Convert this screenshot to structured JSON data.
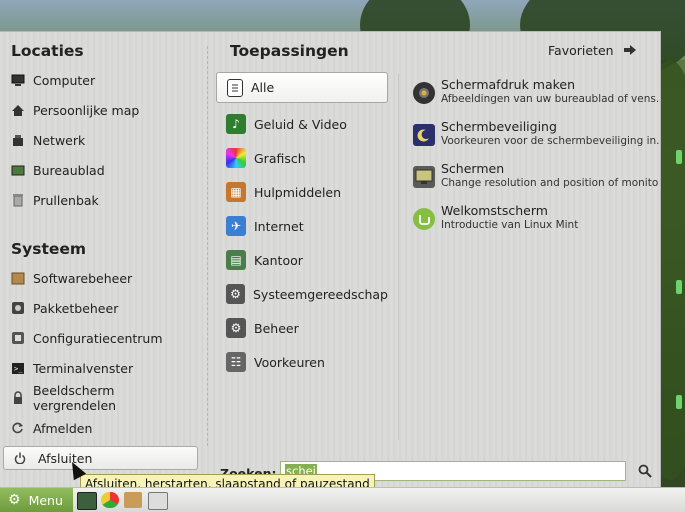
{
  "left_panel": {
    "places_title": "Locaties",
    "places": [
      {
        "label": "Computer",
        "icon": "computer-icon"
      },
      {
        "label": "Persoonlijke map",
        "icon": "home-icon"
      },
      {
        "label": "Netwerk",
        "icon": "network-icon"
      },
      {
        "label": "Bureaublad",
        "icon": "desktop-icon"
      },
      {
        "label": "Prullenbak",
        "icon": "trash-icon"
      }
    ],
    "system_title": "Systeem",
    "system": [
      {
        "label": "Softwarebeheer",
        "icon": "software-manager-icon"
      },
      {
        "label": "Pakketbeheer",
        "icon": "package-manager-icon"
      },
      {
        "label": "Configuratiecentrum",
        "icon": "control-center-icon"
      },
      {
        "label": "Terminalvenster",
        "icon": "terminal-icon"
      },
      {
        "label": "Beeldscherm vergrendelen",
        "icon": "lock-icon"
      },
      {
        "label": "Afmelden",
        "icon": "logout-icon"
      },
      {
        "label": "Afsluiten",
        "icon": "power-icon"
      }
    ]
  },
  "apps_panel": {
    "title": "Toepassingen",
    "favorites_label": "Favorieten",
    "categories": [
      {
        "label": "Alle",
        "icon": "all-apps-icon",
        "color": "#ffffff"
      },
      {
        "label": "Geluid & Video",
        "icon": "sound-video-icon",
        "color": "#2f7d2f"
      },
      {
        "label": "Grafisch",
        "icon": "graphics-icon",
        "color": "#d14bd0"
      },
      {
        "label": "Hulpmiddelen",
        "icon": "accessories-icon",
        "color": "#c5772f"
      },
      {
        "label": "Internet",
        "icon": "internet-icon",
        "color": "#3a7fd0"
      },
      {
        "label": "Kantoor",
        "icon": "office-icon",
        "color": "#4a7d49"
      },
      {
        "label": "Systeemgereedschap",
        "icon": "system-tools-icon",
        "color": "#555555"
      },
      {
        "label": "Beheer",
        "icon": "administration-icon",
        "color": "#555555"
      },
      {
        "label": "Voorkeuren",
        "icon": "preferences-icon",
        "color": "#666666"
      }
    ],
    "applications": [
      {
        "name": "Schermafdruk maken",
        "desc": "Afbeeldingen van uw bureaublad of vens...",
        "icon": "screenshot-icon",
        "color": "#333333"
      },
      {
        "name": "Schermbeveiliging",
        "desc": "Voorkeuren voor de schermbeveiliging in...",
        "icon": "screensaver-icon",
        "color": "#2b2f6b"
      },
      {
        "name": "Schermen",
        "desc": "Change resolution and position of monitors",
        "icon": "display-icon",
        "color": "#5a5a5a"
      },
      {
        "name": "Welkomstscherm",
        "desc": "Introductie van Linux Mint",
        "icon": "mint-logo-icon",
        "color": "#86be43"
      }
    ]
  },
  "search": {
    "label": "Zoeken:",
    "value": "schei"
  },
  "tooltip": "Afsluiten, herstarten, slaapstand of pauzestand",
  "taskbar": {
    "menu_label": "Menu"
  },
  "colors": {
    "accent": "#86b04e",
    "tooltip_bg": "#f7f3b8"
  }
}
